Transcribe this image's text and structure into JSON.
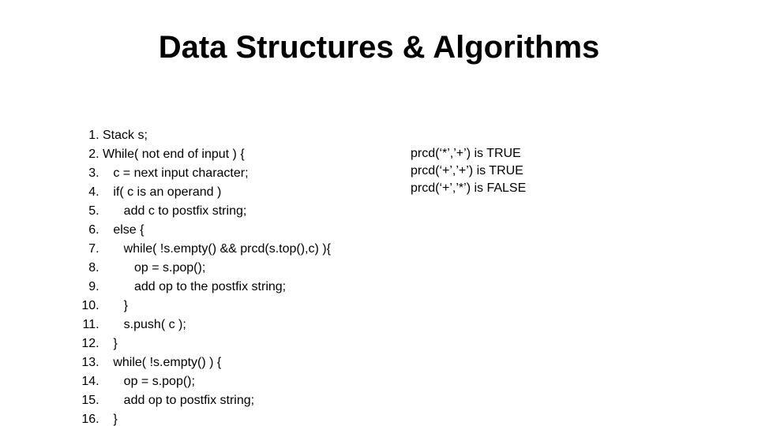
{
  "title": "Data Structures & Algorithms",
  "code_lines": [
    "Stack s;",
    "While( not end of input ) {",
    "   c = next input character;",
    "   if( c is an operand )",
    "      add c to postfix string;",
    "   else {",
    "      while( !s.empty() && prcd(s.top(),c) ){",
    "         op = s.pop();",
    "         add op to the postfix string;",
    "      }",
    "      s.push( c );",
    "   }",
    "   while( !s.empty() ) {",
    "      op = s.pop();",
    "      add op to postfix string;",
    "   }"
  ],
  "notes": [
    "prcd(‘*’,’+’) is TRUE",
    "prcd(‘+’,’+’) is TRUE",
    "prcd(‘+’,’*’) is FALSE"
  ]
}
